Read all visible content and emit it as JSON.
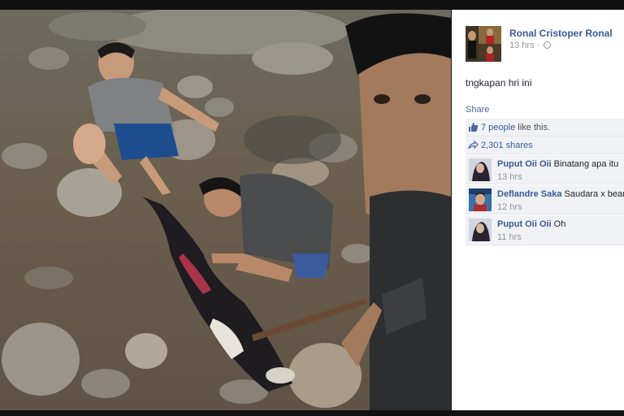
{
  "post": {
    "author": "Ronal Cristoper Ronal",
    "time": "13 hrs",
    "privacy_icon": "globe-icon",
    "text": "tngkapan hri ini",
    "share_label": "Share",
    "likes_count": "7 people",
    "likes_suffix": " like this.",
    "shares": "2,301 shares"
  },
  "comments": [
    {
      "name": "Puput Oii Oii",
      "text": "Binatang apa itu",
      "time": "13 hrs"
    },
    {
      "name": "Deflandre Saka",
      "text": "Saudara x bean",
      "time": "12 hrs"
    },
    {
      "name": "Puput Oii Oii",
      "text": "Oh",
      "time": "11 hrs"
    }
  ],
  "colors": {
    "link": "#3b5998",
    "muted": "#90949c",
    "panel_bg": "#ffffff",
    "stat_bg": "#f0f2f5"
  }
}
